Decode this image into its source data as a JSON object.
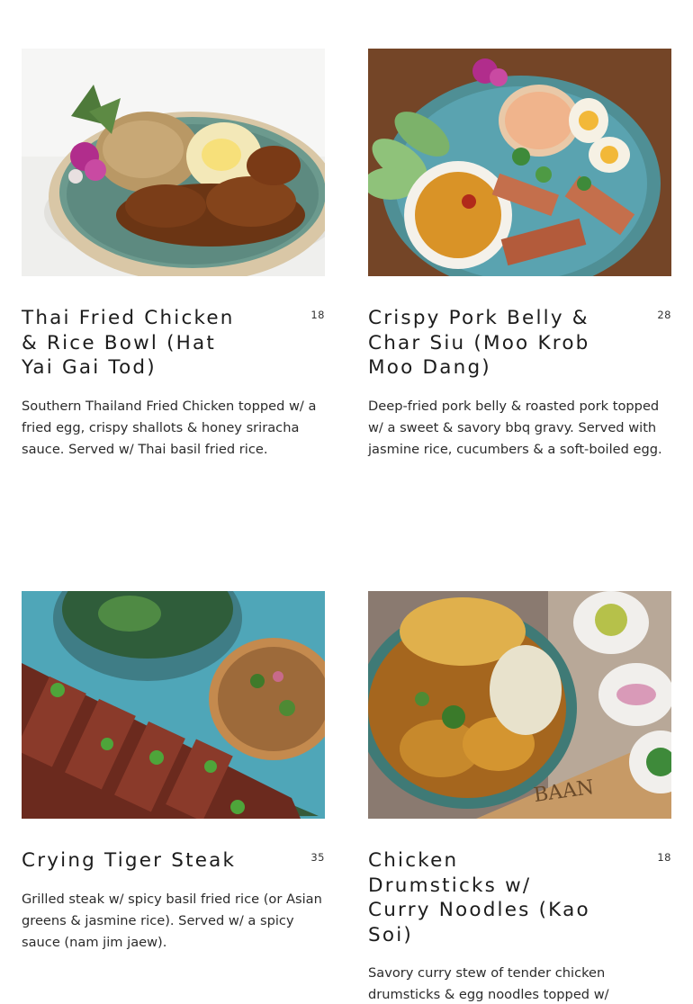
{
  "menu_items": [
    {
      "title": "Thai Fried Chicken & Rice Bowl (Hat Yai Gai Tod)",
      "price": "18",
      "description": "Southern Thailand Fried Chicken topped w/ a fried egg, crispy shallots & honey sriracha sauce. Served w/ Thai basil fried rice.",
      "image": "fried-chicken-rice-bowl-photo"
    },
    {
      "title": "Crispy Pork Belly & Char Siu (Moo Krob Moo Dang)",
      "price": "28",
      "description": "Deep-fried pork belly & roasted pork topped w/ a sweet & savory bbq gravy.  Served with jasmine rice, cucumbers & a soft-boiled egg.",
      "image": "pork-belly-char-siu-photo"
    },
    {
      "title": "Crying Tiger Steak",
      "price": "35",
      "description": "Grilled steak w/ spicy basil fried rice (or Asian greens & jasmine rice). Served w/ a spicy sauce (nam jim jaew).",
      "image": "crying-tiger-steak-photo"
    },
    {
      "title": "Chicken Drumsticks w/ Curry Noodles (Kao Soi)",
      "price": "18",
      "description": "Savory curry stew of tender chicken drumsticks & egg noodles topped w/",
      "image": "kao-soi-photo"
    }
  ],
  "colors": {
    "text": "#1c1c1c",
    "background": "#ffffff",
    "bowl_teal": "#4f8f8a",
    "plate_blue": "#5aa3b0"
  }
}
